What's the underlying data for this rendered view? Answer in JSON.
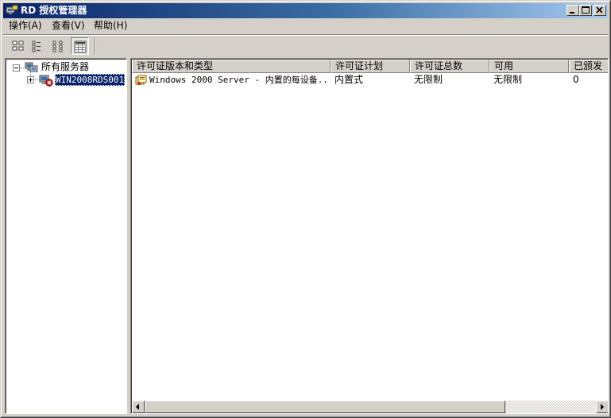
{
  "window": {
    "title": "RD 授权管理器"
  },
  "menu": {
    "items": [
      {
        "label": "操作(A)"
      },
      {
        "label": "查看(V)"
      },
      {
        "label": "帮助(H)"
      }
    ]
  },
  "tree": {
    "root_label": "所有服务器",
    "server_label": "WIN2008RDS001"
  },
  "list": {
    "columns": [
      {
        "label": "许可证版本和类型"
      },
      {
        "label": "许可证计划"
      },
      {
        "label": "许可证总数"
      },
      {
        "label": "可用"
      },
      {
        "label": "已颁发"
      }
    ],
    "rows": [
      {
        "license": "Windows 2000 Server - 内置的每设备...",
        "plan": "内置式",
        "total": "无限制",
        "available": "无限制",
        "issued": "0"
      }
    ]
  },
  "colors": {
    "titlebar_start": "#0a246a",
    "titlebar_end": "#a6caf0",
    "selection": "#0a246a",
    "face": "#d4d0c8"
  }
}
